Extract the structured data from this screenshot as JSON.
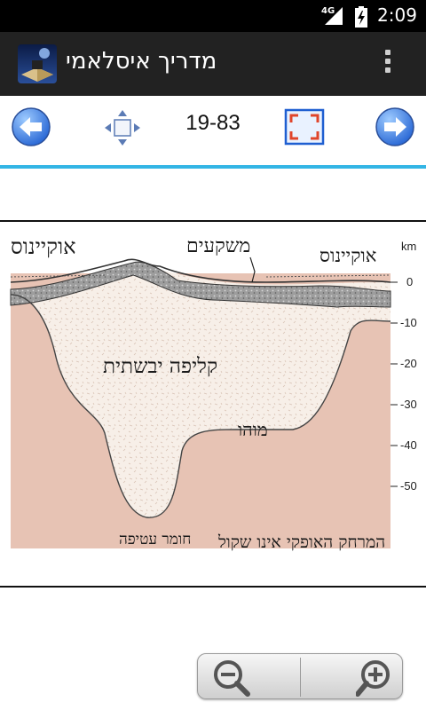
{
  "status_bar": {
    "network": "4G",
    "time": "2:09"
  },
  "action_bar": {
    "title": "מדריך איסלאמי"
  },
  "toolbar": {
    "page_indicator": "19-83"
  },
  "figure": {
    "labels": {
      "ocean_left": "אוקיינוס",
      "ocean_right": "אוקיינוס",
      "sediments": "משקעים",
      "continental_crust": "קליפה יבשתית",
      "moho": "מוהו",
      "mantle": "חומר עטיפה",
      "scale_note": "המרחק האופקי אינו שקול"
    },
    "depth_axis": {
      "unit": "km",
      "ticks": [
        "0",
        "-10",
        "-20",
        "-30",
        "-40",
        "-50"
      ]
    }
  },
  "colors": {
    "accent": "#33b5e5",
    "mantle": "#e7c3b4",
    "crust": "#f7efe8"
  }
}
